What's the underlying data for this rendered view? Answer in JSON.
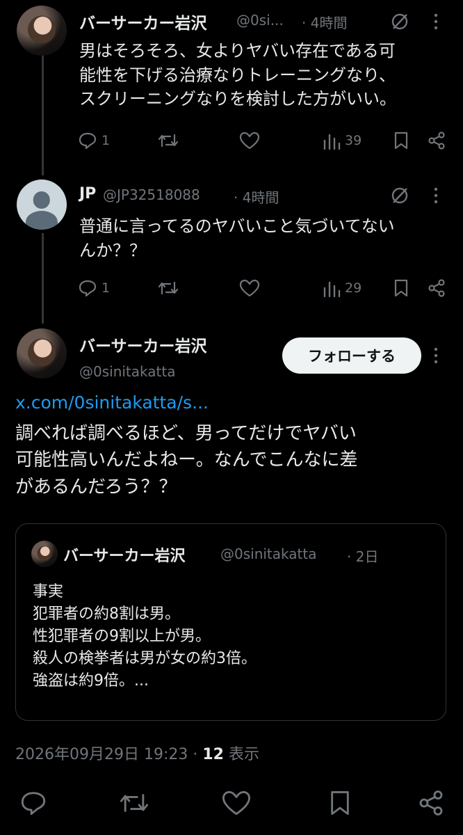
{
  "tweets": [
    {
      "author": "バーサーカー岩沢",
      "handle": "@0si...",
      "time": "· 4時間",
      "text": "男はそろそろ、女よりヤバい存在である可\n能性を下げる治療なりトレーニングなり、\nスクリーニングなりを検討した方がいい。",
      "replies": "1",
      "views": "39"
    },
    {
      "author": "JP",
      "handle": "@JP32518088",
      "time": "· 4時間",
      "text": "普通に言ってるのヤバいこと気づいてない\nんか？？",
      "replies": "1",
      "views": "29"
    }
  ],
  "main_tweet": {
    "author": "バーサーカー岩沢",
    "handle": "@0sinitakatta",
    "follow_label": "フォローする",
    "link": "x.com/0sinitakatta/s...",
    "text": "調べれば調べるほど、男ってだけでヤバい\n可能性高いんだよねー。なんでこんなに差\nがあるんだろう？？",
    "quote": {
      "author": "バーサーカー岩沢",
      "handle": "@0sinitakatta",
      "time": "· 2日",
      "text": "事実\n犯罪者の約8割は男。\n性犯罪者の9割以上が男。\n殺人の検挙者は男が女の約3倍。\n強盗は約9倍。..."
    },
    "date": "2026年09月29日 19:23",
    "views_count": "12",
    "views_label": "表示",
    "separator": "·"
  },
  "colors": {
    "background": "#000000",
    "text": "#e7e9ea",
    "muted": "#71767b",
    "link": "#1d9bf0",
    "border": "#2f3336"
  },
  "icons": [
    "reply-icon",
    "retweet-icon",
    "like-icon",
    "views-icon",
    "bookmark-icon",
    "share-icon",
    "grok-icon",
    "more-icon"
  ]
}
